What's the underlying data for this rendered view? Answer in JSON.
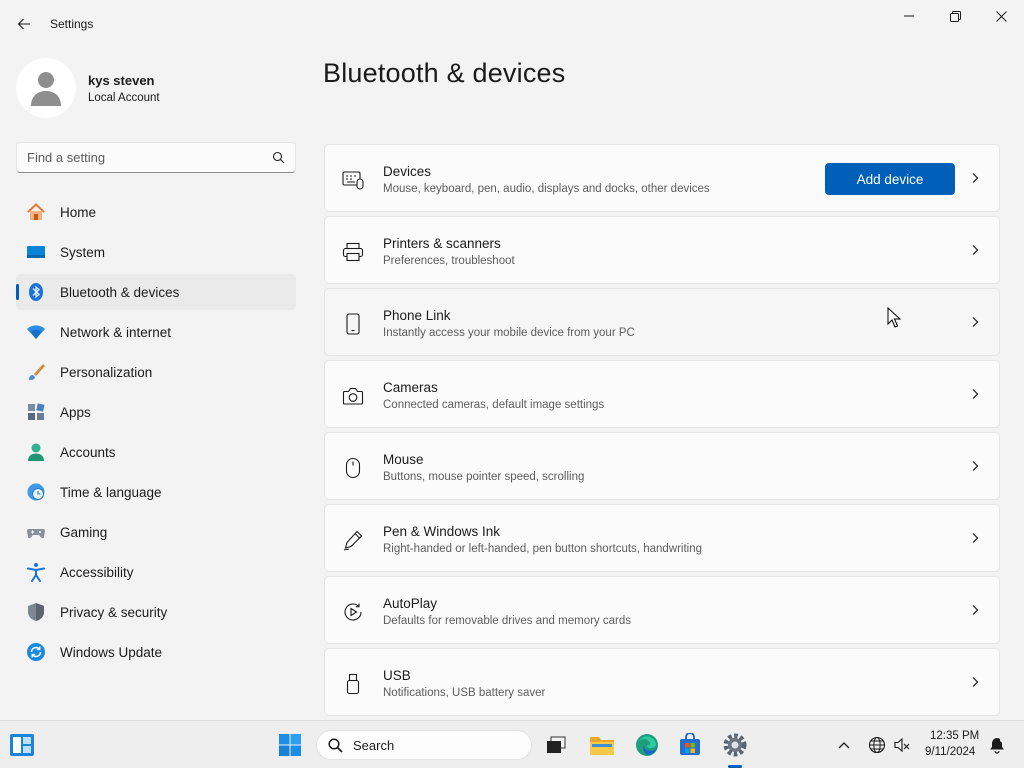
{
  "window": {
    "title": "Settings"
  },
  "profile": {
    "name": "kys steven",
    "account_type": "Local Account"
  },
  "search": {
    "placeholder": "Find a setting"
  },
  "nav": {
    "items": [
      {
        "label": "Home",
        "icon": "home-icon"
      },
      {
        "label": "System",
        "icon": "system-icon"
      },
      {
        "label": "Bluetooth & devices",
        "icon": "bluetooth-icon",
        "active": true
      },
      {
        "label": "Network & internet",
        "icon": "wifi-icon"
      },
      {
        "label": "Personalization",
        "icon": "brush-icon"
      },
      {
        "label": "Apps",
        "icon": "apps-icon"
      },
      {
        "label": "Accounts",
        "icon": "person-icon"
      },
      {
        "label": "Time & language",
        "icon": "clock-globe-icon"
      },
      {
        "label": "Gaming",
        "icon": "gamepad-icon"
      },
      {
        "label": "Accessibility",
        "icon": "accessibility-icon"
      },
      {
        "label": "Privacy & security",
        "icon": "shield-icon"
      },
      {
        "label": "Windows Update",
        "icon": "update-icon"
      }
    ]
  },
  "main": {
    "title": "Bluetooth & devices",
    "cards": [
      {
        "title": "Devices",
        "subtitle": "Mouse, keyboard, pen, audio, displays and docks, other devices",
        "icon": "devices-icon",
        "button": "Add device"
      },
      {
        "title": "Printers & scanners",
        "subtitle": "Preferences, troubleshoot",
        "icon": "printer-icon"
      },
      {
        "title": "Phone Link",
        "subtitle": "Instantly access your mobile device from your PC",
        "icon": "phone-icon"
      },
      {
        "title": "Cameras",
        "subtitle": "Connected cameras, default image settings",
        "icon": "camera-icon"
      },
      {
        "title": "Mouse",
        "subtitle": "Buttons, mouse pointer speed, scrolling",
        "icon": "mouse-icon"
      },
      {
        "title": "Pen & Windows Ink",
        "subtitle": "Right-handed or left-handed, pen button shortcuts, handwriting",
        "icon": "pen-icon"
      },
      {
        "title": "AutoPlay",
        "subtitle": "Defaults for removable drives and memory cards",
        "icon": "autoplay-icon"
      },
      {
        "title": "USB",
        "subtitle": "Notifications, USB battery saver",
        "icon": "usb-icon"
      }
    ]
  },
  "taskbar": {
    "search_label": "Search",
    "time": "12:35 PM",
    "date": "9/11/2024"
  },
  "colors": {
    "accent": "#005fb8",
    "background": "#f3f3f3",
    "card": "#fbfbfb"
  }
}
